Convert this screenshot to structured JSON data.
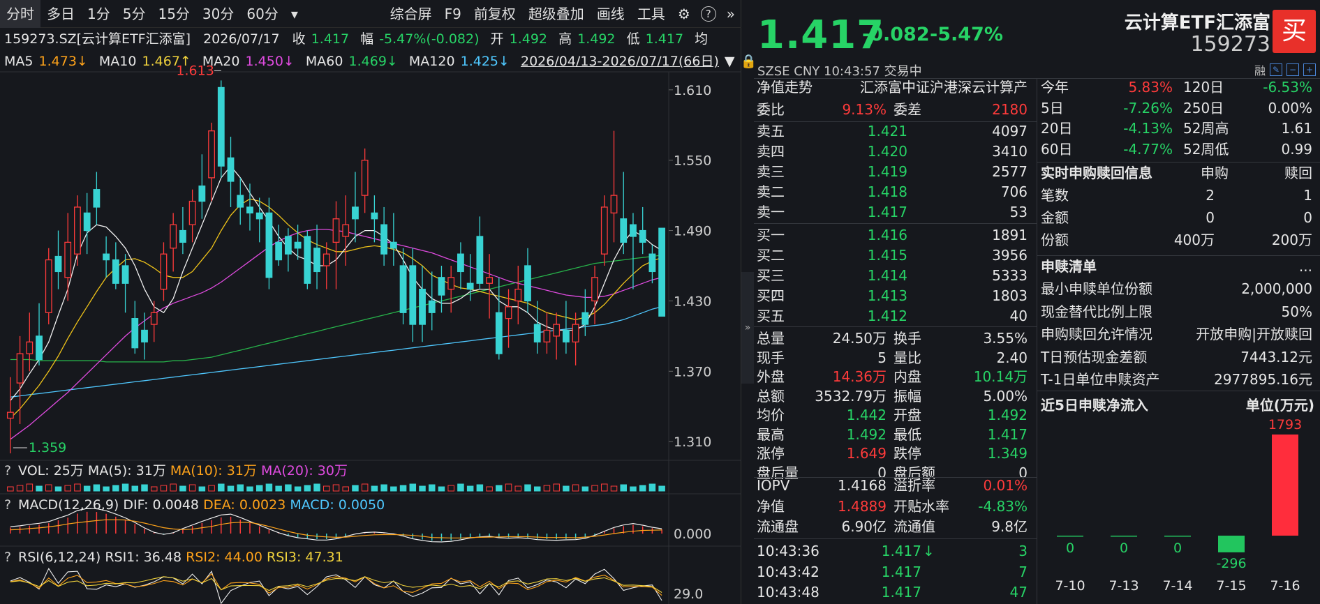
{
  "toolbar": {
    "left": [
      "分时",
      "多日",
      "1分",
      "5分",
      "15分",
      "30分",
      "60分",
      "▾"
    ],
    "right": [
      "综合屏",
      "F9",
      "前复权",
      "超级叠加",
      "画线",
      "工具"
    ],
    "icons": [
      "gear-icon",
      "help-icon",
      "double-chevron-right-icon"
    ]
  },
  "info": {
    "symbol": "159273.SZ[云计算ETF汇添富]",
    "date": "2026/07/17",
    "close_label": "收",
    "close": "1.417",
    "amp_label": "幅",
    "amp": "-5.47%(-0.082)",
    "open_label": "开",
    "open": "1.492",
    "high_label": "高",
    "high": "1.492",
    "low_label": "低",
    "low": "1.417",
    "avg_label": "均"
  },
  "ma": {
    "ma5_label": "MA5",
    "ma5": "1.473↓",
    "ma10_label": "MA10",
    "ma10": "1.467↑",
    "ma20_label": "MA20",
    "ma20": "1.450↓",
    "ma60_label": "MA60",
    "ma60": "1.469↓",
    "ma120_label": "MA120",
    "ma120": "1.425↓",
    "range": "2026/04/13-2026/07/17(66日)"
  },
  "price_axis": [
    "1.610",
    "1.550",
    "1.490",
    "1.430",
    "1.370",
    "1.310"
  ],
  "annotations": {
    "high_mark": "1.613",
    "low_mark": "1.359"
  },
  "vol": {
    "q": "?",
    "label": "VOL: 25万",
    "ma5": "MA(5): 31万",
    "ma10": "MA(10): 31万",
    "ma20": "MA(20): 30万"
  },
  "macd": {
    "q": "?",
    "label": "MACD(12,26,9)",
    "dif": "DIF: 0.0048",
    "dea": "DEA: 0.0023",
    "macd": "MACD: 0.0050",
    "axis": "0.000"
  },
  "rsi": {
    "q": "?",
    "label": "RSI(6,12,24)",
    "rsi1": "RSI1: 36.48",
    "rsi2": "RSI2: 44.00",
    "rsi3": "RSI3: 47.31",
    "axis": "29.0"
  },
  "header": {
    "price": "1.417",
    "change": "-0.082",
    "pct": "-5.47%",
    "name": "云计算ETF汇添富",
    "code": "159273",
    "buy": "买",
    "meta": "SZSE   CNY   10:43:57   交易中",
    "rong": "融"
  },
  "orderbook": {
    "nav_trend_label": "净值走势",
    "nav_trend_value": "汇添富中证沪港深云计算产",
    "wb_label": "委比",
    "wb": "9.13%",
    "wc_label": "委差",
    "wc": "2180",
    "asks": [
      {
        "label": "卖五",
        "price": "1.421",
        "vol": "4097"
      },
      {
        "label": "卖四",
        "price": "1.420",
        "vol": "3410"
      },
      {
        "label": "卖三",
        "price": "1.419",
        "vol": "2577"
      },
      {
        "label": "卖二",
        "price": "1.418",
        "vol": "706"
      },
      {
        "label": "卖一",
        "price": "1.417",
        "vol": "53"
      }
    ],
    "bids": [
      {
        "label": "买一",
        "price": "1.416",
        "vol": "1891"
      },
      {
        "label": "买二",
        "price": "1.415",
        "vol": "3956"
      },
      {
        "label": "买三",
        "price": "1.414",
        "vol": "5333"
      },
      {
        "label": "买四",
        "price": "1.413",
        "vol": "1803"
      },
      {
        "label": "买五",
        "price": "1.412",
        "vol": "40"
      }
    ]
  },
  "stats": [
    {
      "l1": "总量",
      "v1": "24.50万",
      "c1": "wht",
      "l2": "换手",
      "v2": "3.55%",
      "c2": "wht"
    },
    {
      "l1": "现手",
      "v1": "5",
      "c1": "wht",
      "l2": "量比",
      "v2": "2.40",
      "c2": "wht"
    },
    {
      "l1": "外盘",
      "v1": "14.36万",
      "c1": "red",
      "l2": "内盘",
      "v2": "10.14万",
      "c2": "grn"
    },
    {
      "l1": "总额",
      "v1": "3532.79万",
      "c1": "wht",
      "l2": "振幅",
      "v2": "5.00%",
      "c2": "wht"
    },
    {
      "l1": "均价",
      "v1": "1.442",
      "c1": "grn",
      "l2": "开盘",
      "v2": "1.492",
      "c2": "grn"
    },
    {
      "l1": "最高",
      "v1": "1.492",
      "c1": "grn",
      "l2": "最低",
      "v2": "1.417",
      "c2": "grn"
    },
    {
      "l1": "涨停",
      "v1": "1.649",
      "c1": "red",
      "l2": "跌停",
      "v2": "1.349",
      "c2": "grn"
    },
    {
      "l1": "盘后量",
      "v1": "0",
      "c1": "wht",
      "l2": "盘后额",
      "v2": "0",
      "c2": "wht"
    }
  ],
  "iopv": [
    {
      "l1": "IOPV",
      "v1": "1.4168",
      "c1": "wht",
      "l2": "溢折率",
      "v2": "0.01%",
      "c2": "red"
    },
    {
      "l1": "净值",
      "v1": "1.4889",
      "c1": "red",
      "l2": "开贴水率",
      "v2": "-4.83%",
      "c2": "grn"
    },
    {
      "l1": "流通盘",
      "v1": "6.90亿",
      "c1": "wht",
      "l2": "流通值",
      "v2": "9.8亿",
      "c2": "wht"
    }
  ],
  "ticks": [
    {
      "time": "10:43:36",
      "price": "1.417",
      "arrow": "↓",
      "vol": "3"
    },
    {
      "time": "10:43:42",
      "price": "1.417",
      "arrow": "",
      "vol": "7"
    },
    {
      "time": "10:43:48",
      "price": "1.417",
      "arrow": "",
      "vol": "47"
    }
  ],
  "periods": [
    {
      "l1": "今年",
      "v1": "5.83%",
      "c1": "red",
      "l2": "120日",
      "v2": "-6.53%",
      "c2": "grn"
    },
    {
      "l1": "5日",
      "v1": "-7.26%",
      "c1": "grn",
      "l2": "250日",
      "v2": "0.00%",
      "c2": "wht"
    },
    {
      "l1": "20日",
      "v1": "-4.13%",
      "c1": "grn",
      "l2": "52周高",
      "v2": "1.61",
      "c2": "wht"
    },
    {
      "l1": "60日",
      "v1": "-4.77%",
      "c1": "grn",
      "l2": "52周低",
      "v2": "0.99",
      "c2": "wht"
    }
  ],
  "redemption": {
    "title": "实时申购赎回信息",
    "col1": "申购",
    "col2": "赎回",
    "rows": [
      {
        "label": "笔数",
        "a": "2",
        "b": "1"
      },
      {
        "label": "金额",
        "a": "0",
        "b": "0"
      },
      {
        "label": "份额",
        "a": "400万",
        "b": "200万"
      }
    ]
  },
  "list": {
    "title": "申赎清单",
    "more": "...",
    "rows": [
      {
        "label": "最小申赎单位份额",
        "value": "2,000,000"
      },
      {
        "label": "现金替代比例上限",
        "value": "50%"
      },
      {
        "label": "申购赎回允许情况",
        "value": "开放申购|开放赎回"
      },
      {
        "label": "T日预估现金差额",
        "value": "7443.12元"
      },
      {
        "label": "T-1日单位申赎资产",
        "value": "2977895.16元"
      }
    ]
  },
  "flow": {
    "title": "近5日申赎净流入",
    "unit": "单位(万元)",
    "colors": {
      "up": "#ff2d3c",
      "down": "#22c55e",
      "zero": "#22c55e"
    },
    "bars": [
      {
        "date": "7-10",
        "value": 0
      },
      {
        "date": "7-13",
        "value": 0
      },
      {
        "date": "7-14",
        "value": 0
      },
      {
        "date": "7-15",
        "value": -296
      },
      {
        "date": "7-16",
        "value": 1793
      }
    ]
  },
  "chart_data": {
    "type": "candlestick",
    "ylim": [
      1.3,
      1.62
    ],
    "colors": {
      "up": "#ff3b3b",
      "down": "#38d3d3",
      "ma5": "#f0f0f0",
      "ma10": "#f0c419",
      "ma20": "#e04be0",
      "ma60": "#27b34a",
      "ma120": "#4fc8ff"
    },
    "candles": [
      [
        1.33,
        1.365,
        1.3,
        1.335
      ],
      [
        1.36,
        1.4,
        1.325,
        1.385
      ],
      [
        1.385,
        1.42,
        1.37,
        1.395
      ],
      [
        1.4,
        1.428,
        1.375,
        1.38
      ],
      [
        1.42,
        1.475,
        1.41,
        1.465
      ],
      [
        1.468,
        1.49,
        1.44,
        1.455
      ],
      [
        1.45,
        1.505,
        1.43,
        1.48
      ],
      [
        1.47,
        1.52,
        1.46,
        1.51
      ],
      [
        1.505,
        1.522,
        1.47,
        1.49
      ],
      [
        1.525,
        1.54,
        1.495,
        1.51
      ],
      [
        1.47,
        1.485,
        1.45,
        1.465
      ],
      [
        1.465,
        1.48,
        1.44,
        1.445
      ],
      [
        1.46,
        1.47,
        1.42,
        1.445
      ],
      [
        1.415,
        1.43,
        1.385,
        1.39
      ],
      [
        1.405,
        1.42,
        1.38,
        1.395
      ],
      [
        1.41,
        1.43,
        1.395,
        1.42
      ],
      [
        1.44,
        1.48,
        1.43,
        1.47
      ],
      [
        1.475,
        1.505,
        1.455,
        1.495
      ],
      [
        1.49,
        1.51,
        1.47,
        1.48
      ],
      [
        1.495,
        1.525,
        1.48,
        1.515
      ],
      [
        1.528,
        1.555,
        1.5,
        1.515
      ],
      [
        1.535,
        1.582,
        1.515,
        1.575
      ],
      [
        1.612,
        1.618,
        1.535,
        1.545
      ],
      [
        1.552,
        1.57,
        1.51,
        1.532
      ],
      [
        1.52,
        1.535,
        1.495,
        1.51
      ],
      [
        1.51,
        1.53,
        1.49,
        1.505
      ],
      [
        1.505,
        1.518,
        1.48,
        1.5
      ],
      [
        1.505,
        1.518,
        1.44,
        1.45
      ],
      [
        1.48,
        1.495,
        1.46,
        1.465
      ],
      [
        1.485,
        1.492,
        1.455,
        1.47
      ],
      [
        1.48,
        1.495,
        1.465,
        1.475
      ],
      [
        1.485,
        1.49,
        1.44,
        1.445
      ],
      [
        1.475,
        1.495,
        1.44,
        1.455
      ],
      [
        1.46,
        1.48,
        1.44,
        1.47
      ],
      [
        1.48,
        1.515,
        1.44,
        1.5
      ],
      [
        1.485,
        1.52,
        1.46,
        1.495
      ],
      [
        1.51,
        1.54,
        1.48,
        1.5
      ],
      [
        1.52,
        1.56,
        1.505,
        1.55
      ],
      [
        1.505,
        1.52,
        1.48,
        1.5
      ],
      [
        1.495,
        1.51,
        1.46,
        1.47
      ],
      [
        1.48,
        1.505,
        1.46,
        1.475
      ],
      [
        1.46,
        1.475,
        1.41,
        1.42
      ],
      [
        1.46,
        1.475,
        1.395,
        1.41
      ],
      [
        1.44,
        1.46,
        1.395,
        1.41
      ],
      [
        1.43,
        1.455,
        1.405,
        1.42
      ],
      [
        1.45,
        1.46,
        1.42,
        1.435
      ],
      [
        1.44,
        1.46,
        1.42,
        1.45
      ],
      [
        1.47,
        1.48,
        1.44,
        1.455
      ],
      [
        1.445,
        1.47,
        1.43,
        1.44
      ],
      [
        1.485,
        1.502,
        1.44,
        1.445
      ],
      [
        1.445,
        1.47,
        1.415,
        1.45
      ],
      [
        1.42,
        1.45,
        1.38,
        1.385
      ],
      [
        1.415,
        1.44,
        1.39,
        1.425
      ],
      [
        1.43,
        1.46,
        1.41,
        1.44
      ],
      [
        1.46,
        1.475,
        1.42,
        1.43
      ],
      [
        1.41,
        1.43,
        1.385,
        1.395
      ],
      [
        1.395,
        1.42,
        1.385,
        1.405
      ],
      [
        1.4,
        1.42,
        1.38,
        1.41
      ],
      [
        1.405,
        1.43,
        1.385,
        1.395
      ],
      [
        1.395,
        1.42,
        1.375,
        1.41
      ],
      [
        1.42,
        1.44,
        1.4,
        1.41
      ],
      [
        1.43,
        1.46,
        1.41,
        1.45
      ],
      [
        1.47,
        1.52,
        1.46,
        1.51
      ],
      [
        1.505,
        1.575,
        1.48,
        1.52
      ],
      [
        1.5,
        1.54,
        1.47,
        1.48
      ],
      [
        1.495,
        1.505,
        1.44,
        1.485
      ],
      [
        1.49,
        1.51,
        1.47,
        1.48
      ],
      [
        1.47,
        1.478,
        1.445,
        1.455
      ],
      [
        1.492,
        1.492,
        1.417,
        1.417
      ]
    ],
    "ma5": [
      1.345,
      1.355,
      1.368,
      1.38,
      1.395,
      1.418,
      1.44,
      1.47,
      1.488,
      1.495,
      1.493,
      1.485,
      1.475,
      1.46,
      1.44,
      1.425,
      1.42,
      1.432,
      1.455,
      1.475,
      1.495,
      1.515,
      1.535,
      1.545,
      1.535,
      1.522,
      1.51,
      1.498,
      1.485,
      1.475,
      1.468,
      1.465,
      1.46,
      1.46,
      1.465,
      1.475,
      1.485,
      1.49,
      1.49,
      1.485,
      1.478,
      1.465,
      1.45,
      1.44,
      1.432,
      1.428,
      1.428,
      1.432,
      1.438,
      1.44,
      1.44,
      1.43,
      1.425,
      1.425,
      1.42,
      1.412,
      1.408,
      1.405,
      1.405,
      1.405,
      1.41,
      1.425,
      1.445,
      1.465,
      1.48,
      1.49,
      1.485,
      1.478,
      1.473
    ],
    "ma10": [
      1.33,
      1.338,
      1.348,
      1.358,
      1.37,
      1.383,
      1.398,
      1.412,
      1.425,
      1.438,
      1.45,
      1.458,
      1.465,
      1.466,
      1.463,
      1.458,
      1.452,
      1.45,
      1.45,
      1.455,
      1.465,
      1.475,
      1.49,
      1.503,
      1.512,
      1.517,
      1.515,
      1.51,
      1.503,
      1.495,
      1.488,
      1.482,
      1.478,
      1.475,
      1.472,
      1.472,
      1.474,
      1.476,
      1.477,
      1.476,
      1.474,
      1.471,
      1.466,
      1.46,
      1.452,
      1.448,
      1.444,
      1.441,
      1.44,
      1.438,
      1.436,
      1.434,
      1.432,
      1.43,
      1.428,
      1.424,
      1.42,
      1.418,
      1.416,
      1.414,
      1.416,
      1.42,
      1.427,
      1.436,
      1.445,
      1.453,
      1.46,
      1.464,
      1.467
    ],
    "ma20": [
      1.312,
      1.318,
      1.324,
      1.331,
      1.338,
      1.345,
      1.352,
      1.36,
      1.368,
      1.376,
      1.384,
      1.392,
      1.4,
      1.407,
      1.413,
      1.419,
      1.424,
      1.428,
      1.431,
      1.434,
      1.437,
      1.441,
      1.446,
      1.452,
      1.458,
      1.464,
      1.47,
      1.476,
      1.481,
      1.485,
      1.488,
      1.49,
      1.491,
      1.491,
      1.49,
      1.489,
      1.487,
      1.485,
      1.483,
      1.481,
      1.479,
      1.477,
      1.475,
      1.473,
      1.471,
      1.468,
      1.465,
      1.462,
      1.459,
      1.456,
      1.453,
      1.45,
      1.447,
      1.445,
      1.443,
      1.441,
      1.439,
      1.437,
      1.435,
      1.434,
      1.433,
      1.433,
      1.434,
      1.436,
      1.439,
      1.442,
      1.445,
      1.448,
      1.45
    ],
    "ma60": [
      1.38,
      1.38,
      1.38,
      1.379,
      1.379,
      1.379,
      1.379,
      1.379,
      1.379,
      1.379,
      1.378,
      1.378,
      1.378,
      1.378,
      1.378,
      1.378,
      1.378,
      1.379,
      1.379,
      1.38,
      1.381,
      1.382,
      1.384,
      1.386,
      1.388,
      1.39,
      1.392,
      1.394,
      1.396,
      1.398,
      1.4,
      1.402,
      1.404,
      1.406,
      1.408,
      1.41,
      1.412,
      1.414,
      1.416,
      1.418,
      1.42,
      1.422,
      1.424,
      1.426,
      1.428,
      1.43,
      1.432,
      1.434,
      1.436,
      1.438,
      1.44,
      1.442,
      1.444,
      1.446,
      1.448,
      1.45,
      1.452,
      1.454,
      1.456,
      1.458,
      1.46,
      1.462,
      1.463,
      1.464,
      1.465,
      1.466,
      1.467,
      1.468,
      1.469
    ],
    "ma120": [
      1.348,
      1.349,
      1.35,
      1.351,
      1.352,
      1.353,
      1.354,
      1.355,
      1.356,
      1.357,
      1.358,
      1.359,
      1.36,
      1.361,
      1.362,
      1.363,
      1.364,
      1.365,
      1.366,
      1.367,
      1.368,
      1.369,
      1.37,
      1.371,
      1.372,
      1.373,
      1.374,
      1.375,
      1.376,
      1.377,
      1.378,
      1.379,
      1.38,
      1.381,
      1.382,
      1.383,
      1.384,
      1.385,
      1.386,
      1.387,
      1.388,
      1.389,
      1.39,
      1.391,
      1.392,
      1.393,
      1.394,
      1.395,
      1.396,
      1.397,
      1.398,
      1.399,
      1.4,
      1.401,
      1.402,
      1.403,
      1.404,
      1.405,
      1.406,
      1.407,
      1.408,
      1.409,
      1.41,
      1.412,
      1.414,
      1.417,
      1.42,
      1.423,
      1.425
    ]
  }
}
